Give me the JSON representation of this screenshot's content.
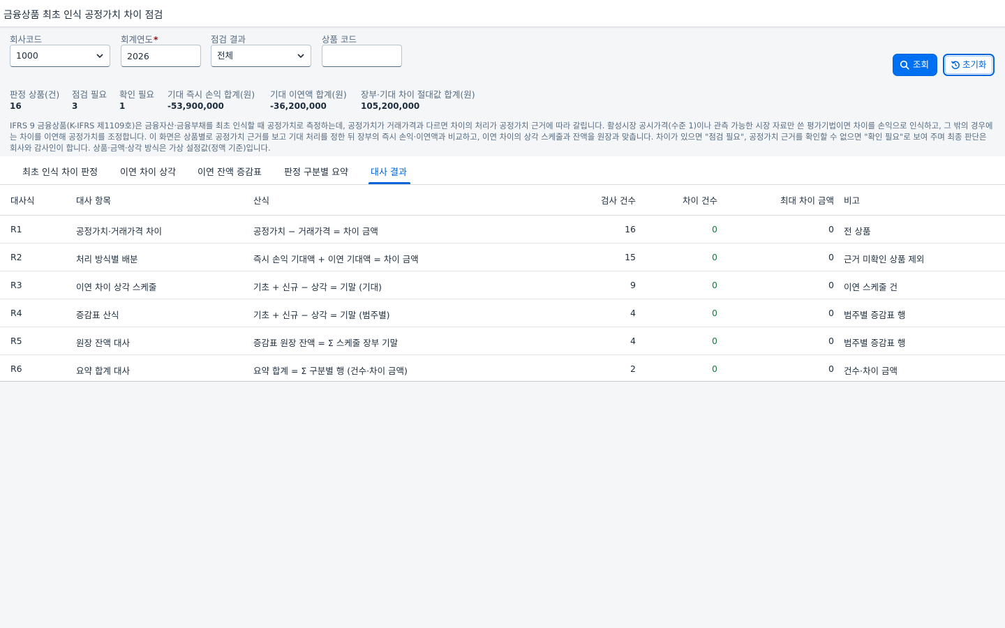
{
  "app": {
    "title": "금융상품 최초 인식 공정가치 차이 점검"
  },
  "filters": {
    "company": {
      "label": "회사코드",
      "value": "1000"
    },
    "year": {
      "label": "회계연도",
      "required_mark": "*",
      "value": "2026"
    },
    "result": {
      "label": "점검 결과",
      "value": "전체"
    },
    "product": {
      "label": "상품 코드",
      "value": ""
    }
  },
  "actions": {
    "search_label": "조회",
    "reset_label": "초기화"
  },
  "kpis": [
    {
      "label": "판정 상품(건)",
      "value": "16"
    },
    {
      "label": "점검 필요",
      "value": "3"
    },
    {
      "label": "확인 필요",
      "value": "1"
    },
    {
      "label": "기대 즉시 손익 합계(원)",
      "value": "-53,900,000"
    },
    {
      "label": "기대 이연액 합계(원)",
      "value": "-36,200,000"
    },
    {
      "label": "장부·기대 차이 절대값 합계(원)",
      "value": "105,200,000"
    }
  ],
  "note": "IFRS 9 금융상품(K-IFRS 제1109호)은 금융자산·금융부채를 최초 인식할 때 공정가치로 측정하는데, 공정가치가 거래가격과 다르면 차이의 처리가 공정가치 근거에 따라 갈립니다. 활성시장 공시가격(수준 1)이나 관측 가능한 시장 자료만 쓴 평가기법이면 차이를 손익으로 인식하고, 그 밖의 경우에는 차이를 이연해 공정가치를 조정합니다. 이 화면은 상품별로 공정가치 근거를 보고 기대 처리를 정한 뒤 장부의 즉시 손익·이연액과 비교하고, 이연 차이의 상각 스케줄과 잔액을 원장과 맞춥니다. 차이가 있으면 \"점검 필요\", 공정가치 근거를 확인할 수 없으면 \"확인 필요\"로 보여 주며 최종 판단은 회사와 감사인이 합니다. 상품·금액·상각 방식은 가상 설정값(정액 기준)입니다.",
  "tabs": [
    {
      "label": "최초 인식 차이 판정"
    },
    {
      "label": "이연 차이 상각"
    },
    {
      "label": "이연 잔액 증감표"
    },
    {
      "label": "판정 구분별 요약"
    },
    {
      "label": "대사 결과"
    }
  ],
  "table": {
    "columns": [
      "대사식",
      "대사 항목",
      "산식",
      "검사 건수",
      "차이 건수",
      "최대 차이 금액",
      "비고"
    ],
    "rows": [
      {
        "id": "R1",
        "item": "공정가치·거래가격 차이",
        "formula": "공정가치 − 거래가격 = 차이 금액",
        "checked": "16",
        "diffs": "0",
        "max_diff": "0",
        "remark": "전 상품"
      },
      {
        "id": "R2",
        "item": "처리 방식별 배분",
        "formula": "즉시 손익 기대액 + 이연 기대액 = 차이 금액",
        "checked": "15",
        "diffs": "0",
        "max_diff": "0",
        "remark": "근거 미확인 상품 제외"
      },
      {
        "id": "R3",
        "item": "이연 차이 상각 스케줄",
        "formula": "기초 + 신규 − 상각 = 기말 (기대)",
        "checked": "9",
        "diffs": "0",
        "max_diff": "0",
        "remark": "이연 스케줄 건"
      },
      {
        "id": "R4",
        "item": "증감표 산식",
        "formula": "기초 + 신규 − 상각 = 기말 (범주별)",
        "checked": "4",
        "diffs": "0",
        "max_diff": "0",
        "remark": "범주별 증감표 행"
      },
      {
        "id": "R5",
        "item": "원장 잔액 대사",
        "formula": "증감표 원장 잔액 = Σ 스케줄 장부 기말",
        "checked": "4",
        "diffs": "0",
        "max_diff": "0",
        "remark": "범주별 증감표 행"
      },
      {
        "id": "R6",
        "item": "요약 합계 대사",
        "formula": "요약 합계 = Σ 구분별 행 (건수·차이 금액)",
        "checked": "2",
        "diffs": "0",
        "max_diff": "0",
        "remark": "건수·차이 금액"
      }
    ]
  },
  "colors": {
    "accent": "#0070f2",
    "diff_zero": "#107e3e",
    "required": "#aa0808"
  }
}
